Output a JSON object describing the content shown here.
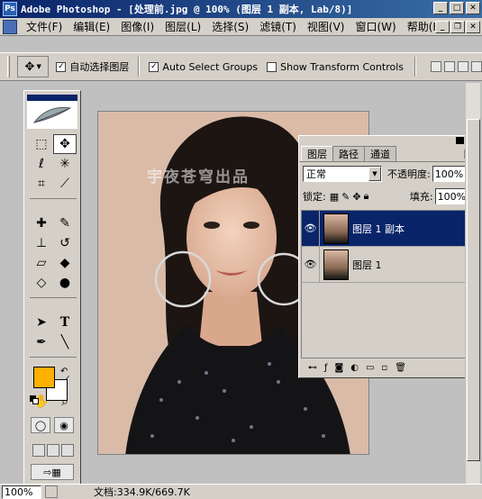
{
  "window": {
    "title": "Adobe Photoshop - [处理前.jpg @ 100% (图层 1 副本, Lab/8)]",
    "buttons": [
      "minimize",
      "maximize",
      "close"
    ]
  },
  "menu": {
    "items": [
      "文件(F)",
      "编辑(E)",
      "图像(I)",
      "图层(L)",
      "选择(S)",
      "滤镜(T)",
      "视图(V)",
      "窗口(W)",
      "帮助(H)"
    ]
  },
  "options": {
    "auto_select_layer": {
      "label": "自动选择图层",
      "checked": true
    },
    "auto_select_groups": {
      "label": "Auto Select Groups",
      "checked": true
    },
    "show_transform": {
      "label": "Show Transform Controls",
      "checked": false
    }
  },
  "canvas": {
    "watermark": "宇夜苍穹出品"
  },
  "layers_panel": {
    "tabs": [
      "图层",
      "路径",
      "通道"
    ],
    "active_tab": "图层",
    "blend_mode": "正常",
    "opacity_label": "不透明度:",
    "opacity_value": "100%",
    "lock_label": "锁定:",
    "fill_label": "填充:",
    "fill_value": "100%",
    "layers": [
      {
        "name": "图层 1 副本",
        "selected": true,
        "visible": true
      },
      {
        "name": "图层 1",
        "selected": false,
        "visible": true
      }
    ]
  },
  "status": {
    "zoom": "100%",
    "doc_info": "文档:334.9K/669.7K"
  },
  "colors": {
    "foreground": "#ffb000",
    "background": "#ffffff",
    "title_bar": "#0a246a",
    "selected_layer": "#0a246a"
  }
}
